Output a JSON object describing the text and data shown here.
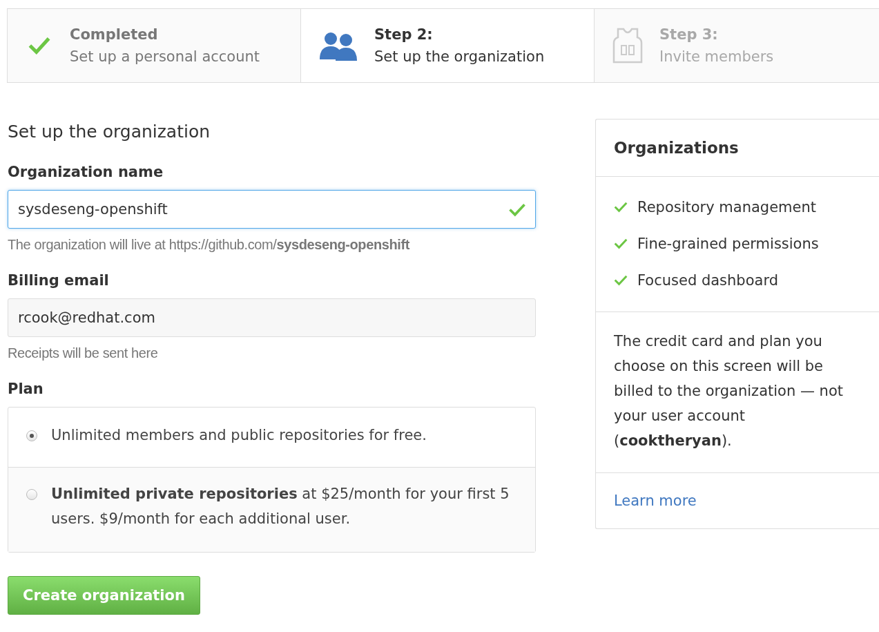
{
  "steps": [
    {
      "kind": "completed",
      "title": "Completed",
      "subtitle": "Set up a personal account"
    },
    {
      "kind": "current",
      "title": "Step 2:",
      "subtitle": "Set up the organization"
    },
    {
      "kind": "pending",
      "title": "Step 3:",
      "subtitle": "Invite members"
    }
  ],
  "form": {
    "heading": "Set up the organization",
    "org_name": {
      "label": "Organization name",
      "value": "sysdeseng-openshift",
      "valid": true,
      "hint": "The organization will live at https://github.com/**sysdeseng-openshift**"
    },
    "billing_email": {
      "label": "Billing email",
      "value": "rcook@redhat.com",
      "hint": "Receipts will be sent here"
    },
    "plan": {
      "label": "Plan",
      "options": [
        {
          "text": "Unlimited members and public repositories for free.",
          "selected": true
        },
        {
          "text": "**Unlimited private repositories** at $25/month for your first 5 users. $9/month for each additional user.",
          "selected": false
        }
      ]
    },
    "submit": "Create organization"
  },
  "sidebar": {
    "title": "Organizations",
    "features": [
      "Repository management",
      "Fine-grained permissions",
      "Focused dashboard"
    ],
    "note": "The credit card and plan you choose on this screen will be billed to the organization — not your user account (**cooktheryan**).",
    "link": "Learn more"
  }
}
